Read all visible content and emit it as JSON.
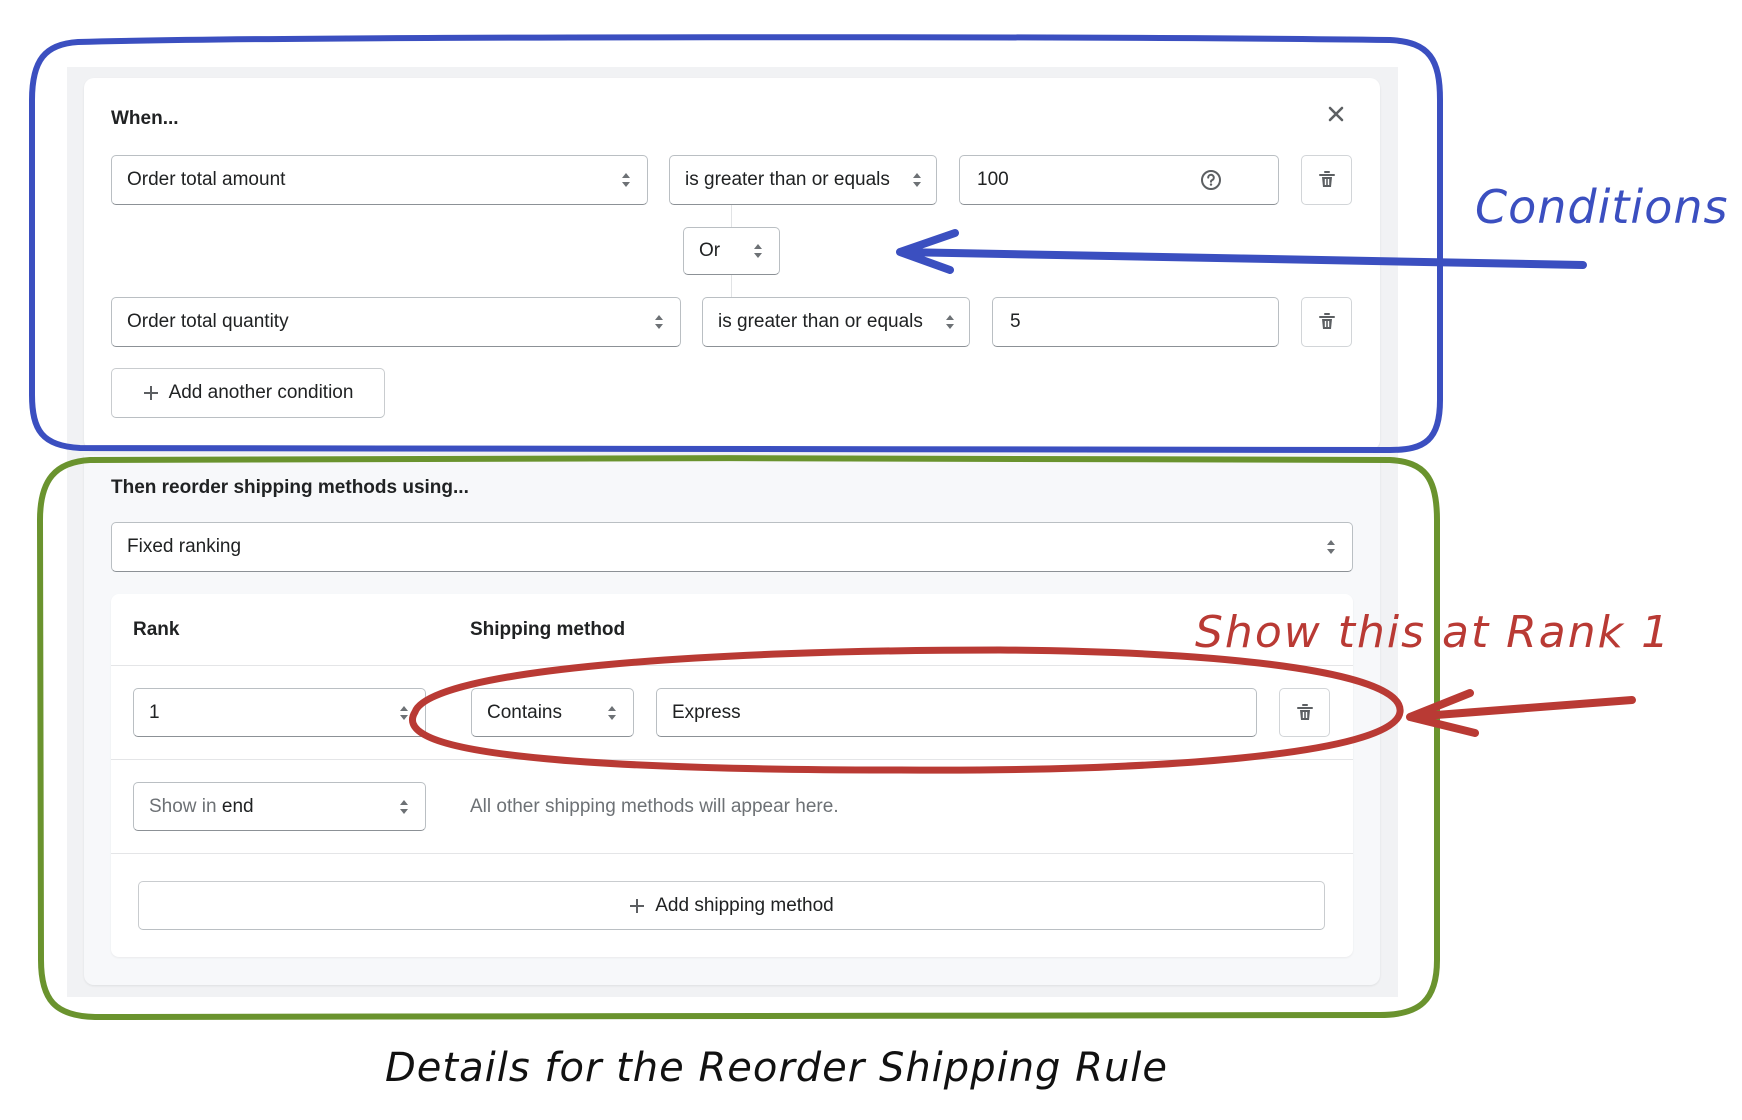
{
  "conditions": {
    "heading": "When...",
    "rows": [
      {
        "field": "Order total amount",
        "operator": "is greater than or equals",
        "value": "100",
        "has_help_icon": true
      },
      {
        "field": "Order total quantity",
        "operator": "is greater than or equals",
        "value": "5",
        "has_help_icon": false
      }
    ],
    "connector": "Or",
    "add_condition_label": "Add another condition"
  },
  "reorder": {
    "heading": "Then reorder shipping methods using...",
    "method": "Fixed ranking",
    "table": {
      "columns": [
        "Rank",
        "Shipping method"
      ],
      "rows": [
        {
          "rank": "1",
          "match_type": "Contains",
          "match_value": "Express"
        }
      ],
      "end_row": {
        "rank_prefix": "Show in ",
        "rank_suffix": "end",
        "description": "All other shipping methods will appear here."
      }
    },
    "add_method_label": "Add shipping method"
  },
  "annotations": {
    "conditions_label": "Conditions",
    "rank_label": "Show this at Rank 1",
    "caption": "Details for the Reorder Shipping Rule",
    "colors": {
      "conditions": "#3b4fc0",
      "reorder": "#6a932e",
      "rank": "#b93a34"
    }
  }
}
